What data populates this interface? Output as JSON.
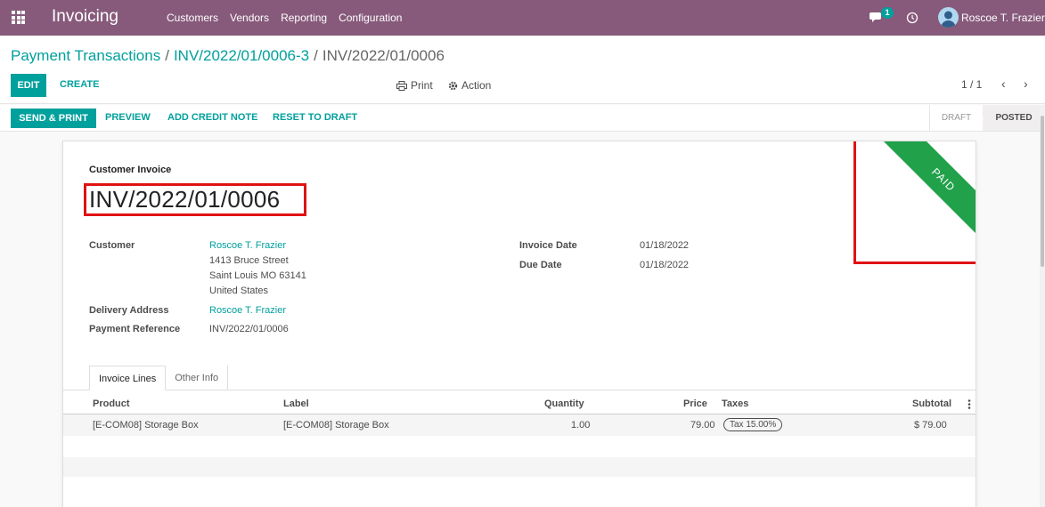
{
  "navbar": {
    "app_name": "Invoicing",
    "menu": [
      "Customers",
      "Vendors",
      "Reporting",
      "Configuration"
    ],
    "chat_badge": "1",
    "user_name": "Roscoe T. Frazier",
    "bg_color": "#875a7b"
  },
  "breadcrumb": {
    "root": "Payment Transactions",
    "middle": "INV/2022/01/0006-3",
    "current": "INV/2022/01/0006",
    "separator": "/"
  },
  "toolbar": {
    "edit_label": "EDIT",
    "create_label": "CREATE",
    "print_label": "Print",
    "action_label": "Action",
    "pager": "1 / 1"
  },
  "statusbar": {
    "send_print": "SEND & PRINT",
    "preview": "PREVIEW",
    "add_credit_note": "ADD CREDIT NOTE",
    "reset_to_draft": "RESET TO DRAFT",
    "stages": [
      "DRAFT",
      "POSTED"
    ],
    "active_stage": "POSTED"
  },
  "invoice": {
    "type": "Customer Invoice",
    "name": "INV/2022/01/0006",
    "ribbon": "PAID",
    "ribbon_color": "#21a14a",
    "customer_label": "Customer",
    "customer_name": "Roscoe T. Frazier",
    "address_line1": "1413 Bruce Street",
    "address_line2": "Saint Louis MO 63141",
    "address_line3": "United States",
    "delivery_label": "Delivery Address",
    "delivery_value": "Roscoe T. Frazier",
    "payment_ref_label": "Payment Reference",
    "payment_ref_value": "INV/2022/01/0006",
    "invoice_date_label": "Invoice Date",
    "invoice_date_value": "01/18/2022",
    "due_date_label": "Due Date",
    "due_date_value": "01/18/2022"
  },
  "tabs": [
    "Invoice Lines",
    "Other Info"
  ],
  "lines": {
    "headers": {
      "product": "Product",
      "label": "Label",
      "quantity": "Quantity",
      "price": "Price",
      "taxes": "Taxes",
      "subtotal": "Subtotal"
    },
    "rows": [
      {
        "product": "[E-COM08] Storage Box",
        "label": "[E-COM08] Storage Box",
        "quantity": "1.00",
        "price": "79.00",
        "tax": "Tax 15.00%",
        "subtotal": "$ 79.00"
      }
    ]
  }
}
